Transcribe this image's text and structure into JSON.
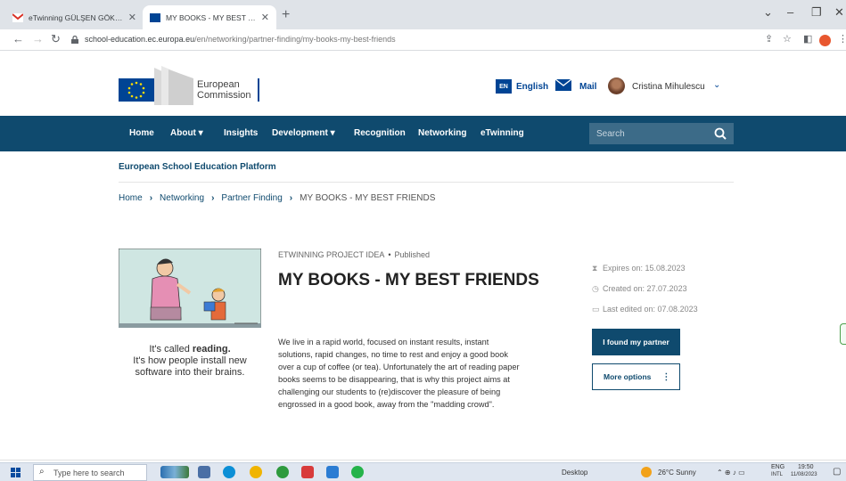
{
  "browser": {
    "tabs": [
      {
        "title": "eTwinning GÜLŞEN GÖKÇE work",
        "active": false
      },
      {
        "title": "MY BOOKS - MY BEST FRIENDS",
        "active": true
      }
    ],
    "url_host": "school-education.ec.europa.eu",
    "url_path": "/en/networking/partner-finding/my-books-my-best-friends"
  },
  "header": {
    "logo_line1": "European",
    "logo_line2": "Commission",
    "lang_code": "EN",
    "lang_label": "English",
    "mail_label": "Mail",
    "user_name": "Cristina Mihulescu"
  },
  "nav": {
    "items": [
      "Home",
      "About ▾",
      "Insights",
      "Development ▾",
      "Recognition",
      "Networking",
      "eTwinning"
    ],
    "search_placeholder": "Search"
  },
  "platform_title": "European School Education Platform",
  "breadcrumb": [
    "Home",
    "Networking",
    "Partner Finding",
    "MY BOOKS - MY BEST FRIENDS"
  ],
  "project": {
    "kicker": "ETWINNING PROJECT IDEA",
    "status": "Published",
    "title": "MY BOOKS - MY BEST FRIENDS",
    "image_caption_pre": "It's called ",
    "image_caption_bold": "reading.",
    "image_caption_post": "It's how people install new software into their brains.",
    "description": "We live in a rapid world, focused on instant results, instant solutions, rapid changes, no time to rest and enjoy a good book over a cup of coffee (or tea). Unfortunately the art of reading paper books seems to be disappearing, that is why this project aims at challenging our students to (re)discover the pleasure of being engrossed in a good book, away from the \"madding crowd\"."
  },
  "sidebar": {
    "expires": "Expires on: 15.08.2023",
    "created": "Created on: 27.07.2023",
    "edited": "Last edited on: 07.08.2023",
    "primary_button": "I found my partner",
    "secondary_button": "More options"
  },
  "taskbar": {
    "search_placeholder": "Type here to search",
    "desktop_label": "Desktop",
    "weather": "26°C  Sunny",
    "lang": "ENG",
    "lang2": "INTL",
    "time": "19:50",
    "date": "11/08/2023"
  },
  "colors": {
    "nav_bg": "#0f4a6e",
    "brand_blue": "#004494"
  }
}
